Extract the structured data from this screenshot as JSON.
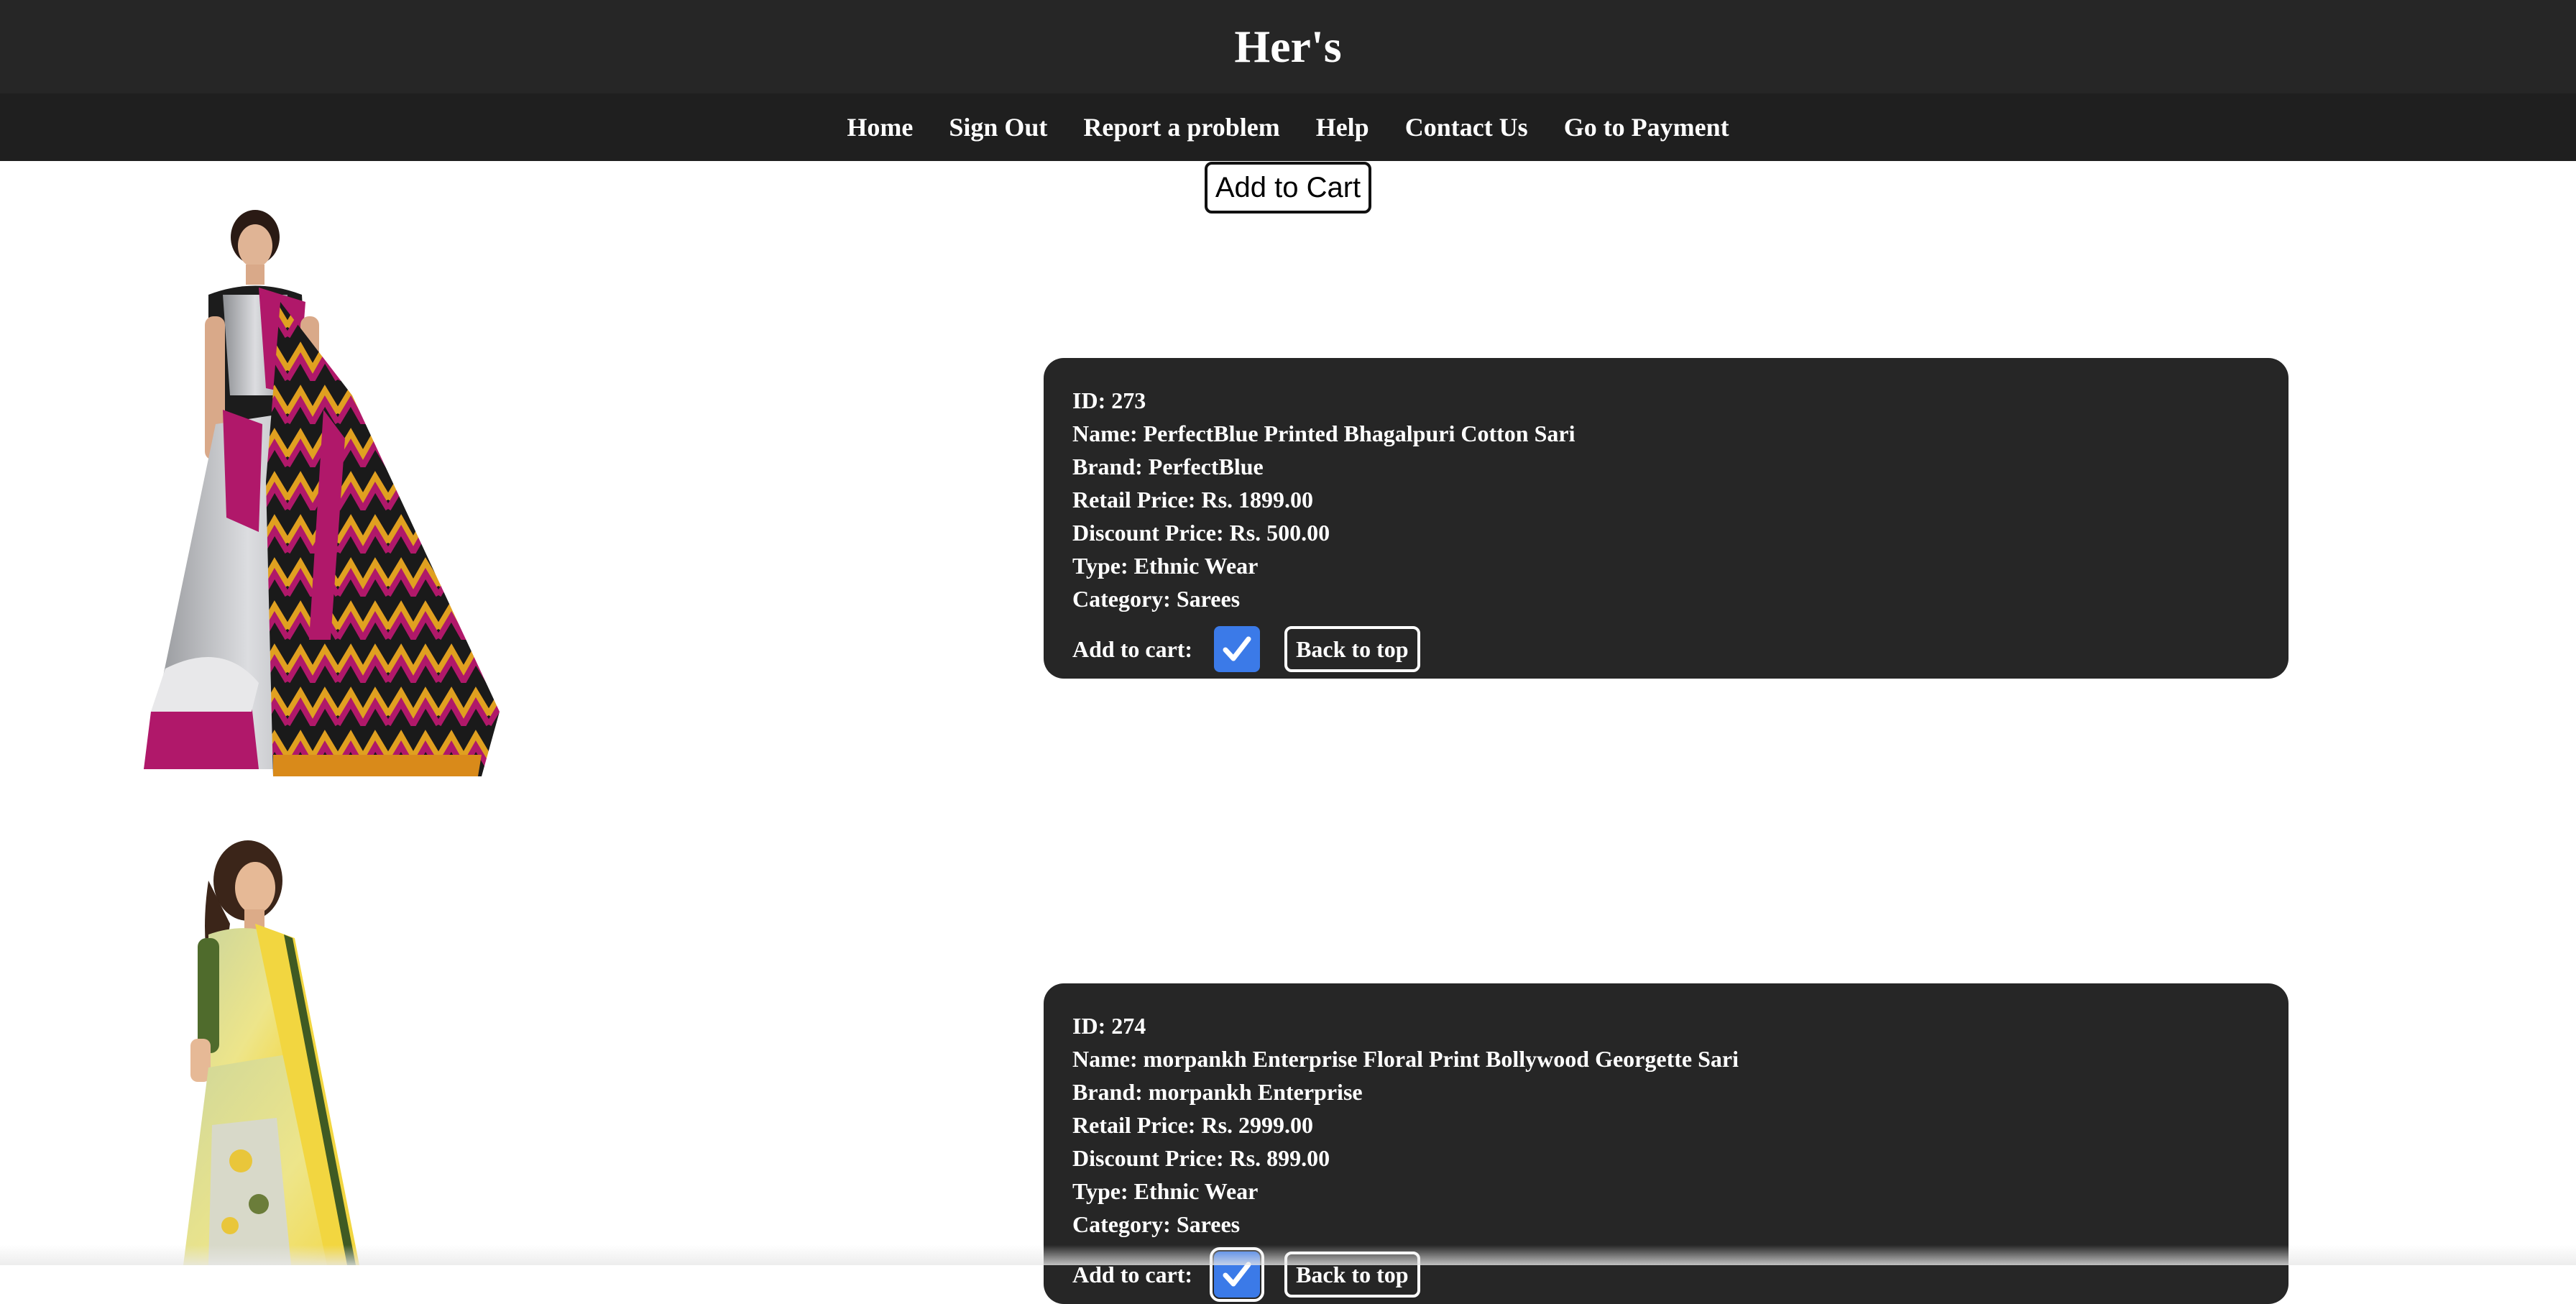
{
  "header": {
    "title": "Her's"
  },
  "nav": {
    "items": [
      {
        "label": "Home"
      },
      {
        "label": "Sign Out"
      },
      {
        "label": "Report a problem"
      },
      {
        "label": "Help"
      },
      {
        "label": "Contact Us"
      },
      {
        "label": "Go to Payment"
      }
    ]
  },
  "add_to_cart_button": "Add to Cart",
  "products": [
    {
      "id_line": "ID: 273",
      "name_line": "Name: PerfectBlue Printed Bhagalpuri Cotton Sari",
      "brand_line": "Brand: PerfectBlue",
      "retail_line": "Retail Price: Rs. 1899.00",
      "discount_line": "Discount Price: Rs. 500.00",
      "type_line": "Type: Ethnic Wear",
      "category_line": "Category: Sarees",
      "cart_label": "Add to cart:",
      "checked": true,
      "back_to_top": "Back to top"
    },
    {
      "id_line": "ID: 274",
      "name_line": "Name: morpankh Enterprise Floral Print Bollywood Georgette Sari",
      "brand_line": "Brand: morpankh Enterprise",
      "retail_line": "Retail Price: Rs. 2999.00",
      "discount_line": "Discount Price: Rs. 899.00",
      "type_line": "Type: Ethnic Wear",
      "category_line": "Category: Sarees",
      "cart_label": "Add to cart:",
      "checked": true,
      "back_to_top": "Back to top"
    }
  ],
  "colors": {
    "header_bg": "#262626",
    "nav_bg": "#1f1f1f",
    "card_bg": "#262626",
    "checkbox": "#3b7ae8"
  }
}
